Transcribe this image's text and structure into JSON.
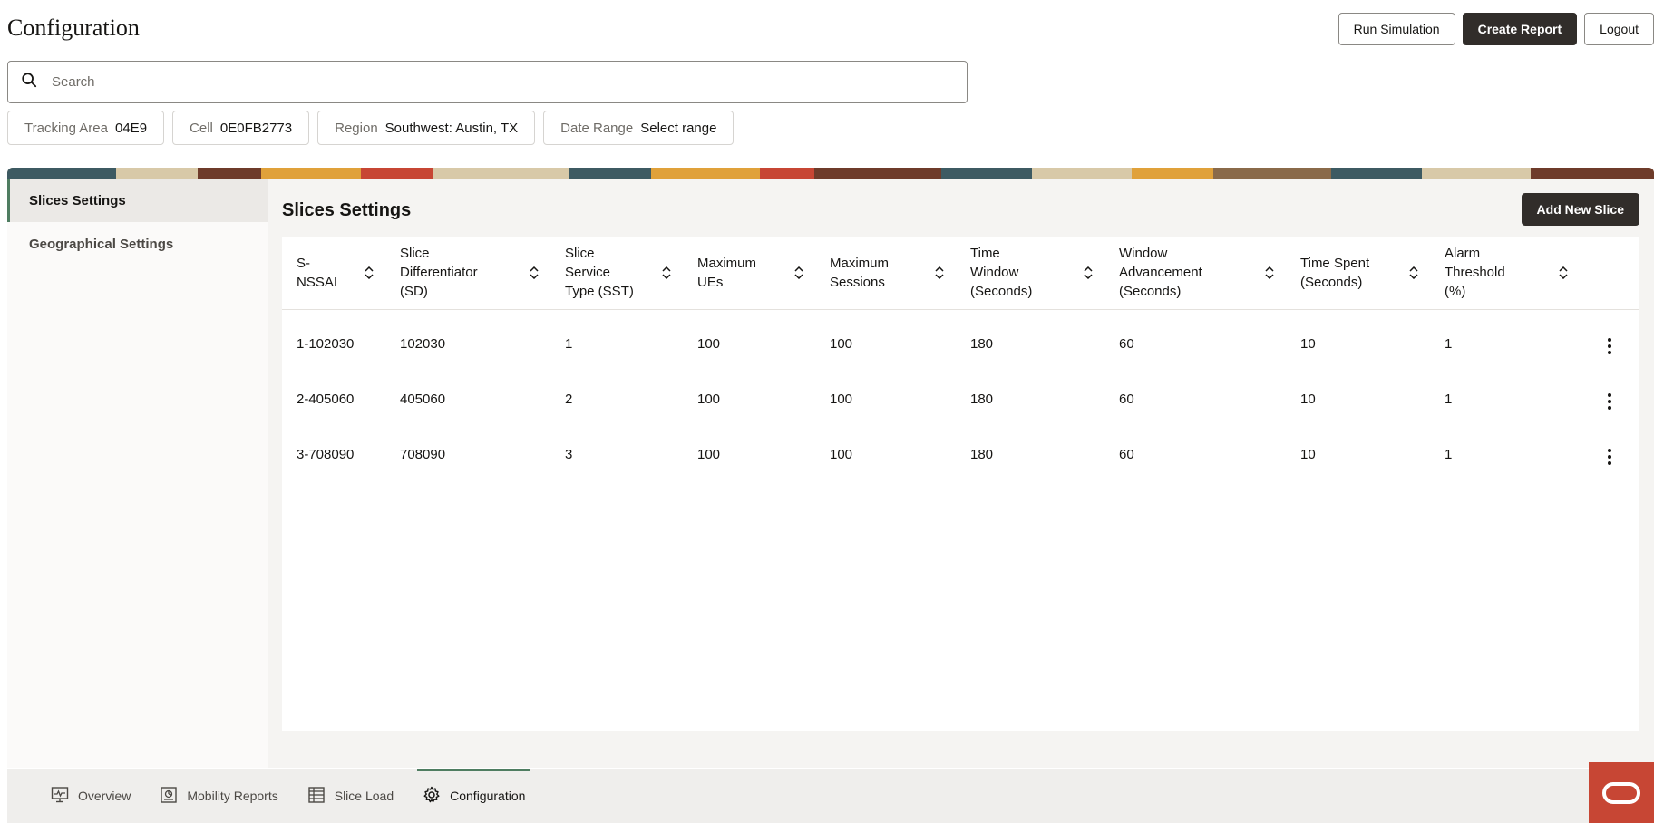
{
  "page": {
    "title": "Configuration"
  },
  "actions": {
    "run_simulation": "Run Simulation",
    "create_report": "Create Report",
    "logout": "Logout"
  },
  "search": {
    "placeholder": "Search",
    "value": ""
  },
  "filters": [
    {
      "label": "Tracking Area",
      "value": "04E9"
    },
    {
      "label": "Cell",
      "value": "0E0FB2773"
    },
    {
      "label": "Region",
      "value": "Southwest: Austin, TX"
    },
    {
      "label": "Date Range",
      "value": "Select range"
    }
  ],
  "sidenav": {
    "items": [
      "Slices Settings",
      "Geographical Settings"
    ],
    "active": 0
  },
  "content": {
    "title": "Slices Settings",
    "add_button": "Add New Slice"
  },
  "table": {
    "columns": [
      "S-NSSAI",
      "Slice Differentiator (SD)",
      "Slice Service Type (SST)",
      "Maximum UEs",
      "Maximum Sessions",
      "Time Window (Seconds)",
      "Window Advancement (Seconds)",
      "Time Spent (Seconds)",
      "Alarm Threshold (%)"
    ],
    "rows": [
      [
        "1-102030",
        "102030",
        "1",
        "100",
        "100",
        "180",
        "60",
        "10",
        "1"
      ],
      [
        "2-405060",
        "405060",
        "2",
        "100",
        "100",
        "180",
        "60",
        "10",
        "1"
      ],
      [
        "3-708090",
        "708090",
        "3",
        "100",
        "100",
        "180",
        "60",
        "10",
        "1"
      ]
    ]
  },
  "bottom_tabs": [
    {
      "label": "Overview",
      "icon": "monitor-icon"
    },
    {
      "label": "Mobility Reports",
      "icon": "report-icon"
    },
    {
      "label": "Slice Load",
      "icon": "grid-icon"
    },
    {
      "label": "Configuration",
      "icon": "gear-icon"
    }
  ],
  "active_tab": 3,
  "colors": {
    "accent": "#4f7d61",
    "dark_button": "#312d2a",
    "brand": "#c74634"
  }
}
